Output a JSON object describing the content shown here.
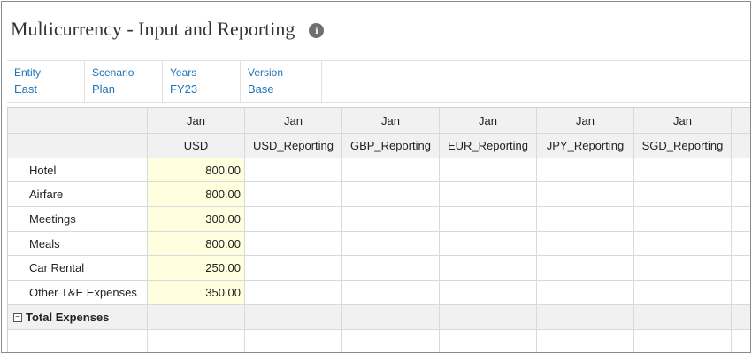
{
  "title": "Multicurrency - Input and Reporting",
  "pov": [
    {
      "label": "Entity",
      "value": "East"
    },
    {
      "label": "Scenario",
      "value": "Plan"
    },
    {
      "label": "Years",
      "value": "FY23"
    },
    {
      "label": "Version",
      "value": "Base"
    }
  ],
  "grid": {
    "period_headers": [
      "Jan",
      "Jan",
      "Jan",
      "Jan",
      "Jan",
      "Jan"
    ],
    "currency_headers": [
      "USD",
      "USD_Reporting",
      "GBP_Reporting",
      "EUR_Reporting",
      "JPY_Reporting",
      "SGD_Reporting"
    ],
    "rows": [
      {
        "label": "Hotel",
        "usd": "800.00"
      },
      {
        "label": "Airfare",
        "usd": "800.00"
      },
      {
        "label": "Meetings",
        "usd": "300.00"
      },
      {
        "label": "Meals",
        "usd": "800.00"
      },
      {
        "label": "Car Rental",
        "usd": "250.00"
      },
      {
        "label": "Other T&E Expenses",
        "usd": "350.00"
      }
    ],
    "total_label": "Total Expenses"
  },
  "colors": {
    "link": "#1f73b7",
    "input_cell": "#ffffe0",
    "header_bg": "#f1f1f1"
  }
}
